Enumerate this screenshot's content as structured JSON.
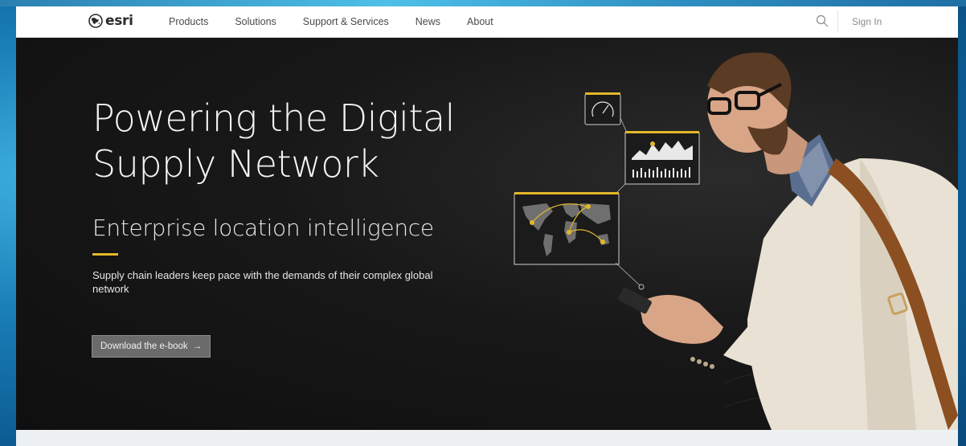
{
  "brand": {
    "name": "esri"
  },
  "nav": {
    "items": [
      {
        "label": "Products"
      },
      {
        "label": "Solutions"
      },
      {
        "label": "Support & Services"
      },
      {
        "label": "News"
      },
      {
        "label": "About"
      }
    ],
    "sign_in": "Sign In"
  },
  "hero": {
    "title": "Powering the Digital Supply Network",
    "subtitle": "Enterprise location intelligence",
    "body": "Supply chain leaders keep pace with the demands of their complex global network",
    "cta": {
      "label": "Download the e-book",
      "arrow": "→"
    }
  },
  "colors": {
    "accent": "#e2b72b",
    "hero_bg": "#151515",
    "nav_bg": "#ffffff"
  },
  "icons": [
    "globe-icon",
    "search-icon",
    "arrow-right-icon",
    "gauge-icon",
    "chart-icon",
    "world-map-icon",
    "phone-icon"
  ]
}
